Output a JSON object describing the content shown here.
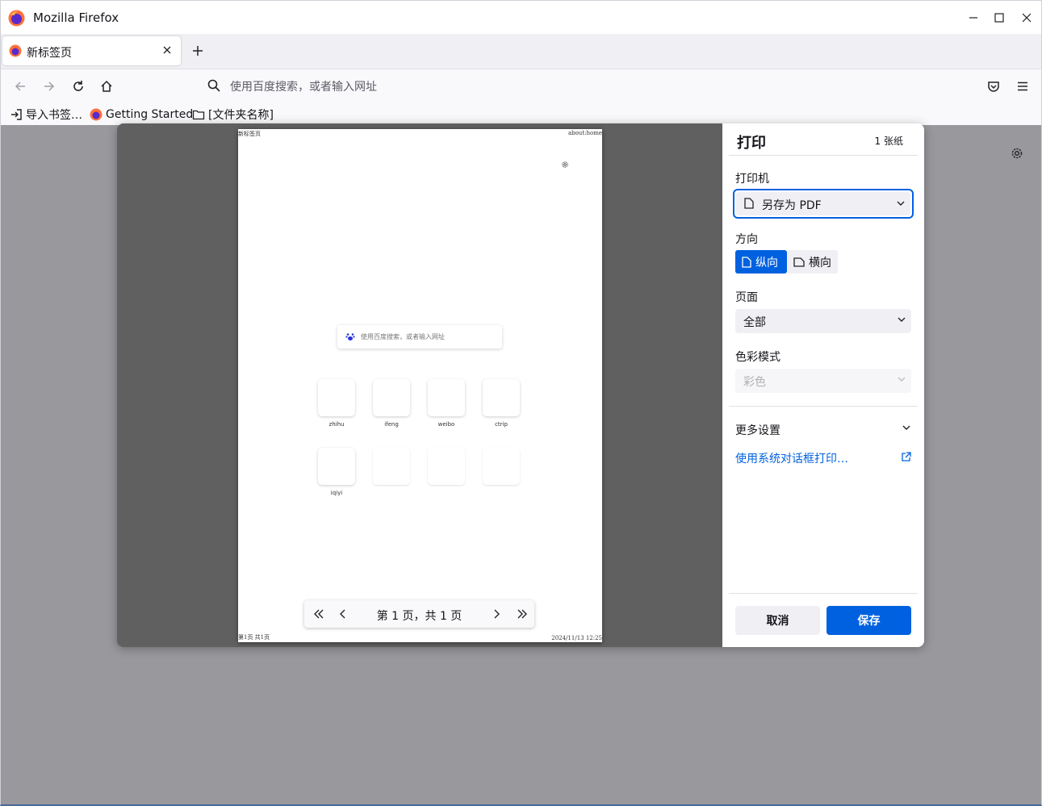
{
  "window": {
    "title": "Mozilla Firefox"
  },
  "tabs": [
    {
      "label": "新标签页"
    }
  ],
  "urlbar": {
    "placeholder": "使用百度搜索，或者输入网址"
  },
  "bookmarks": [
    {
      "label": "导入书签…",
      "icon": "import-icon"
    },
    {
      "label": "Getting Started",
      "icon": "firefox-icon"
    },
    {
      "label": "[文件夹名称]",
      "icon": "folder-icon"
    }
  ],
  "preview": {
    "header_left": "新标签页",
    "header_right": "about:home",
    "footer_left": "第1页 共1页",
    "footer_right": "2024/11/13 12:25",
    "search_placeholder": "使用百度搜索，或者输入网址",
    "top_sites": [
      {
        "label": "zhihu"
      },
      {
        "label": "ifeng"
      },
      {
        "label": "weibo"
      },
      {
        "label": "ctrip"
      },
      {
        "label": "iqiyi"
      }
    ],
    "pager": {
      "text": "第 1 页，共 1 页"
    }
  },
  "print": {
    "heading": "打印",
    "sheet_count": "1 张纸",
    "printer_label": "打印机",
    "printer_value": "另存为 PDF",
    "orientation_label": "方向",
    "portrait": "纵向",
    "landscape": "横向",
    "pages_label": "页面",
    "pages_value": "全部",
    "color_label": "色彩模式",
    "color_value": "彩色",
    "more_settings": "更多设置",
    "system_dialog": "使用系统对话框打印…",
    "cancel": "取消",
    "save": "保存"
  },
  "colors": {
    "accent": "#0061e0",
    "preview_bg": "#606060",
    "content_bg": "#98989d"
  }
}
